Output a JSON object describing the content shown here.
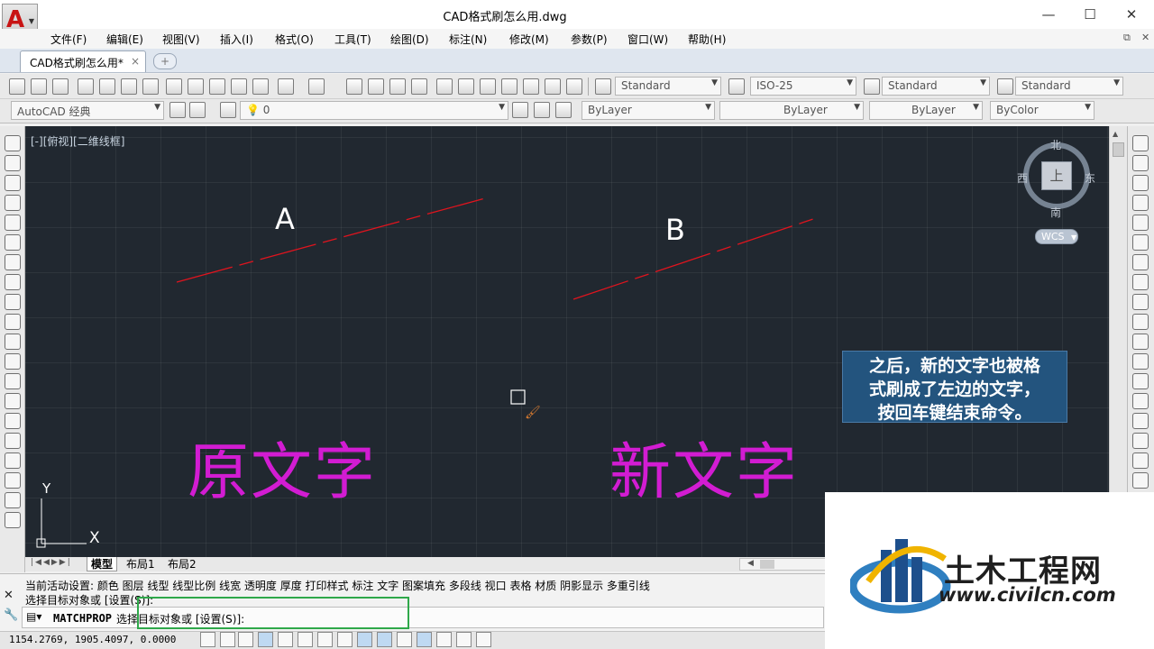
{
  "window": {
    "title": "CAD格式刷怎么用.dwg",
    "app_letter": "A",
    "controls": {
      "minimize": "—",
      "maximize": "☐",
      "close": "✕"
    }
  },
  "menu": {
    "items": [
      "文件(F)",
      "编辑(E)",
      "视图(V)",
      "插入(I)",
      "格式(O)",
      "工具(T)",
      "绘图(D)",
      "标注(N)",
      "修改(M)",
      "参数(P)",
      "窗口(W)",
      "帮助(H)"
    ]
  },
  "tabs": {
    "document": "CAD格式刷怎么用*",
    "close": "×",
    "new_tab": "+"
  },
  "toolbar": {
    "text_style": "Standard",
    "dim_style": "ISO-25",
    "table_style": "Standard",
    "mleader_style": "Standard",
    "workspace": "AutoCAD 经典",
    "layer": "0",
    "color": "ByLayer",
    "linetype": "ByLayer",
    "lineweight": "ByLayer",
    "plot_style": "ByColor"
  },
  "drawing": {
    "viewport_label": "[-][俯视][二维线框]",
    "label_a": "A",
    "label_b": "B",
    "text_left": "原文字",
    "text_right": "新文字",
    "line_color": "#e0141e",
    "text_color": "#d21cd2",
    "ucs_x": "X",
    "ucs_y": "Y"
  },
  "viewcube": {
    "north": "北",
    "south": "南",
    "east": "东",
    "west": "西",
    "face": "上",
    "wcs": "WCS"
  },
  "layout_tabs": [
    "模型",
    "布局1",
    "布局2"
  ],
  "note": {
    "line1": "之后，新的文字也被格",
    "line2": "式刷成了左边的文字，",
    "line3": "按回车键结束命令。"
  },
  "command": {
    "history_1": "当前活动设置:  颜色 图层 线型 线型比例 线宽 透明度 厚度 打印样式 标注 文字 图案填充 多段线 视口 表格 材质 阴影显示 多重引线",
    "history_2": "选择目标对象或 [设置(S)]:",
    "prompt_cmd": "MATCHPROP",
    "prompt_text": "选择目标对象或 [设置(S)]:"
  },
  "status": {
    "coordinates": "1154.2769, 1905.4097, 0.0000"
  },
  "watermark": {
    "title": "土木工程网",
    "url": "www.civilcn.com"
  }
}
